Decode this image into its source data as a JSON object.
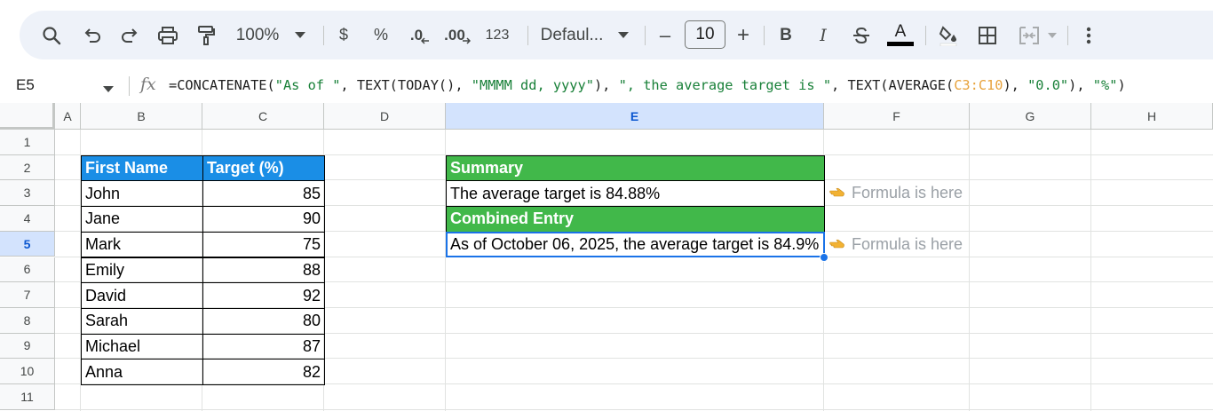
{
  "toolbar": {
    "zoom": "100%",
    "currency_label": "$",
    "percent_label": "%",
    "decrease_decimal_label": ".0",
    "increase_decimal_label": ".00",
    "number_format_label": "123",
    "font_name": "Defaul...",
    "font_size": "10",
    "decrease_size_label": "–",
    "increase_size_label": "+",
    "bold_label": "B",
    "italic_label": "I",
    "text_color_label": "A",
    "text_color": "#000000",
    "icons": [
      "search-icon",
      "undo-icon",
      "redo-icon",
      "print-icon",
      "paint-format-icon",
      "zoom-dropdown-icon",
      "font-dropdown-icon",
      "strikethrough-icon",
      "fill-color-icon",
      "borders-icon",
      "merge-cells-icon",
      "more-options-icon"
    ]
  },
  "formula_bar": {
    "cell_ref": "E5",
    "fx_label": "fx",
    "formula_parts": [
      {
        "text": "=CONCATENATE(",
        "kind": "plain"
      },
      {
        "text": "\"As of \"",
        "kind": "string"
      },
      {
        "text": ", TEXT(TODAY(), ",
        "kind": "plain"
      },
      {
        "text": "\"MMMM dd, yyyy\"",
        "kind": "string"
      },
      {
        "text": "), ",
        "kind": "plain"
      },
      {
        "text": "\", the average target is \"",
        "kind": "string"
      },
      {
        "text": ", TEXT(AVERAGE(",
        "kind": "plain"
      },
      {
        "text": "C3:C10",
        "kind": "ref"
      },
      {
        "text": "), ",
        "kind": "plain"
      },
      {
        "text": "\"0.0\"",
        "kind": "string"
      },
      {
        "text": "), ",
        "kind": "plain"
      },
      {
        "text": "\"%\"",
        "kind": "string"
      },
      {
        "text": ")",
        "kind": "plain"
      }
    ]
  },
  "columns": [
    "A",
    "B",
    "C",
    "D",
    "E",
    "F",
    "G",
    "H"
  ],
  "selected_column": "E",
  "rows": [
    "1",
    "2",
    "3",
    "4",
    "5",
    "6",
    "7",
    "8",
    "9",
    "10",
    "11"
  ],
  "selected_row": "5",
  "table": {
    "headers": [
      "First Name",
      "Target (%)"
    ],
    "header_color": "#1a8ee6",
    "rows": [
      [
        "John",
        "85"
      ],
      [
        "Jane",
        "90"
      ],
      [
        "Mark",
        "75"
      ],
      [
        "Emily",
        "88"
      ],
      [
        "David",
        "92"
      ],
      [
        "Sarah",
        "80"
      ],
      [
        "Michael",
        "87"
      ],
      [
        "Anna",
        "82"
      ]
    ]
  },
  "summary": {
    "summary_label": "Summary",
    "summary_value": "The average target is 84.88%",
    "combined_label": "Combined Entry",
    "combined_value": "As of October 06, 2025, the average target is 84.9%",
    "header_color": "#41b84a"
  },
  "notes": {
    "note_row3": "Formula is here",
    "note_row5": "Formula is here",
    "note_icon": "pointing-hand-icon"
  },
  "colors": {
    "selection": "#1a73e8",
    "header_selected_bg": "#d3e3fd"
  }
}
